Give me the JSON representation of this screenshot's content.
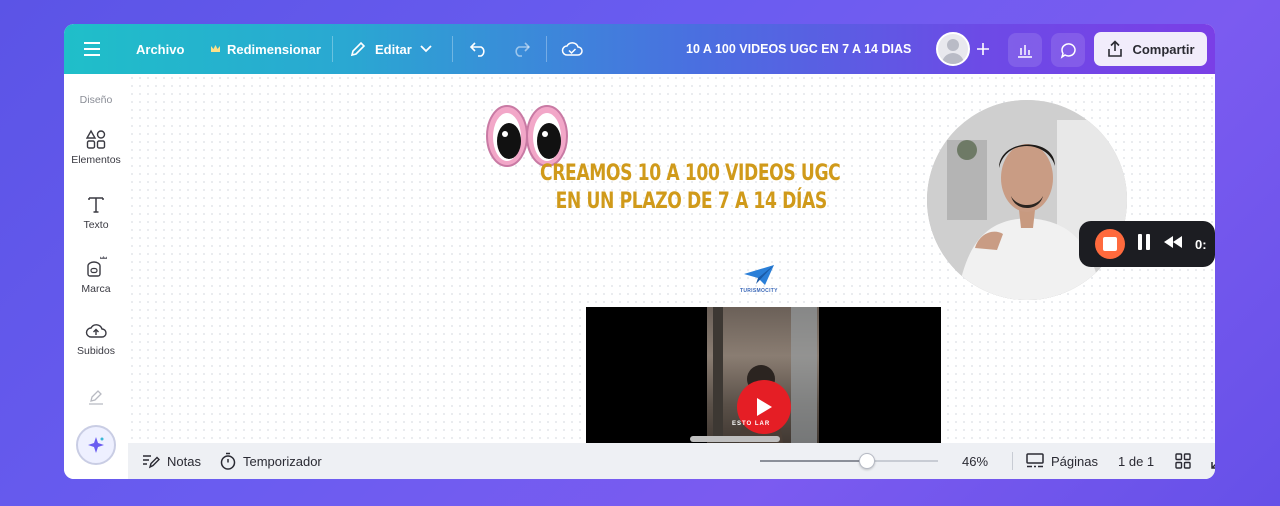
{
  "topbar": {
    "menu_icon": "hamburger-icon",
    "file_label": "Archivo",
    "resize_label": "Redimensionar",
    "edit_label": "Editar",
    "title": "10 A 100 VIDEOS UGC EN 7 A 14 DIAS",
    "share_label": "Compartir"
  },
  "sidebar": {
    "section_label": "Diseño",
    "items": [
      {
        "label": "Elementos",
        "icon": "shapes-icon"
      },
      {
        "label": "Texto",
        "icon": "text-icon"
      },
      {
        "label": "Marca",
        "icon": "brand-icon"
      },
      {
        "label": "Subidos",
        "icon": "upload-cloud-icon"
      }
    ]
  },
  "canvas": {
    "headline_line1": "CREAMOS 10 A 100 VIDEOS UGC",
    "headline_line2": "EN UN PLAZO DE 7 A 14 DÍAS",
    "logo_text": "TURISMOCITY",
    "video_caption": "ESTO       LAR"
  },
  "recorder": {
    "time": "0:"
  },
  "bottombar": {
    "notes_label": "Notas",
    "timer_label": "Temporizador",
    "zoom_value": 46,
    "zoom_label": "46%",
    "pages_label": "Páginas",
    "page_indicator": "1 de 1"
  },
  "colors": {
    "headline": "#d09a1a",
    "play": "#e51e25",
    "record_stop": "#ff6a3d"
  }
}
